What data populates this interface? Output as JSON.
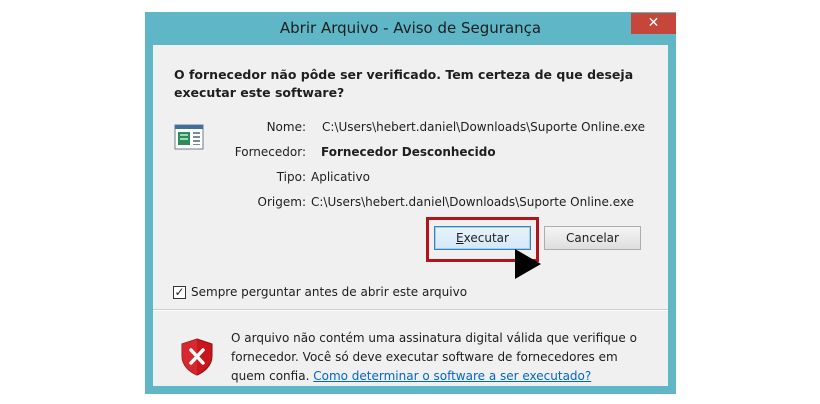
{
  "window": {
    "title": "Abrir Arquivo - Aviso de Segurança",
    "close_glyph": "✕"
  },
  "dialog": {
    "question": "O fornecedor não pôde ser verificado. Tem certeza de que deseja executar este software?",
    "fields": [
      {
        "label": "Nome:",
        "value": "C:\\Users\\hebert.daniel\\Downloads\\Suporte Online.exe"
      },
      {
        "label": "Fornecedor:",
        "value": "Fornecedor Desconhecido"
      },
      {
        "label": "Tipo:",
        "value": "Aplicativo"
      },
      {
        "label": "Origem:",
        "value": "C:\\Users\\hebert.daniel\\Downloads\\Suporte Online.exe"
      }
    ],
    "buttons": {
      "run_label": "Executar",
      "cancel_label": "Cancelar"
    },
    "checkbox": {
      "label": "Sempre perguntar antes de abrir este arquivo",
      "checked": true,
      "mark": "✓"
    },
    "warning": {
      "text": "O arquivo não contém uma assinatura digital válida que verifique o fornecedor. Você só deve executar software de fornecedores em quem confia.",
      "link": "Como determinar o software a ser executado?"
    }
  },
  "icons": {
    "file": "application-file-icon",
    "shield": "security-shield-x-icon",
    "pointer": "arrow-pointer-icon"
  },
  "colors": {
    "window_frame": "#5fb6c6",
    "close_button": "#c7463a",
    "highlight": "#b2141d",
    "link": "#0066cc",
    "shield_red": "#c8161d"
  }
}
